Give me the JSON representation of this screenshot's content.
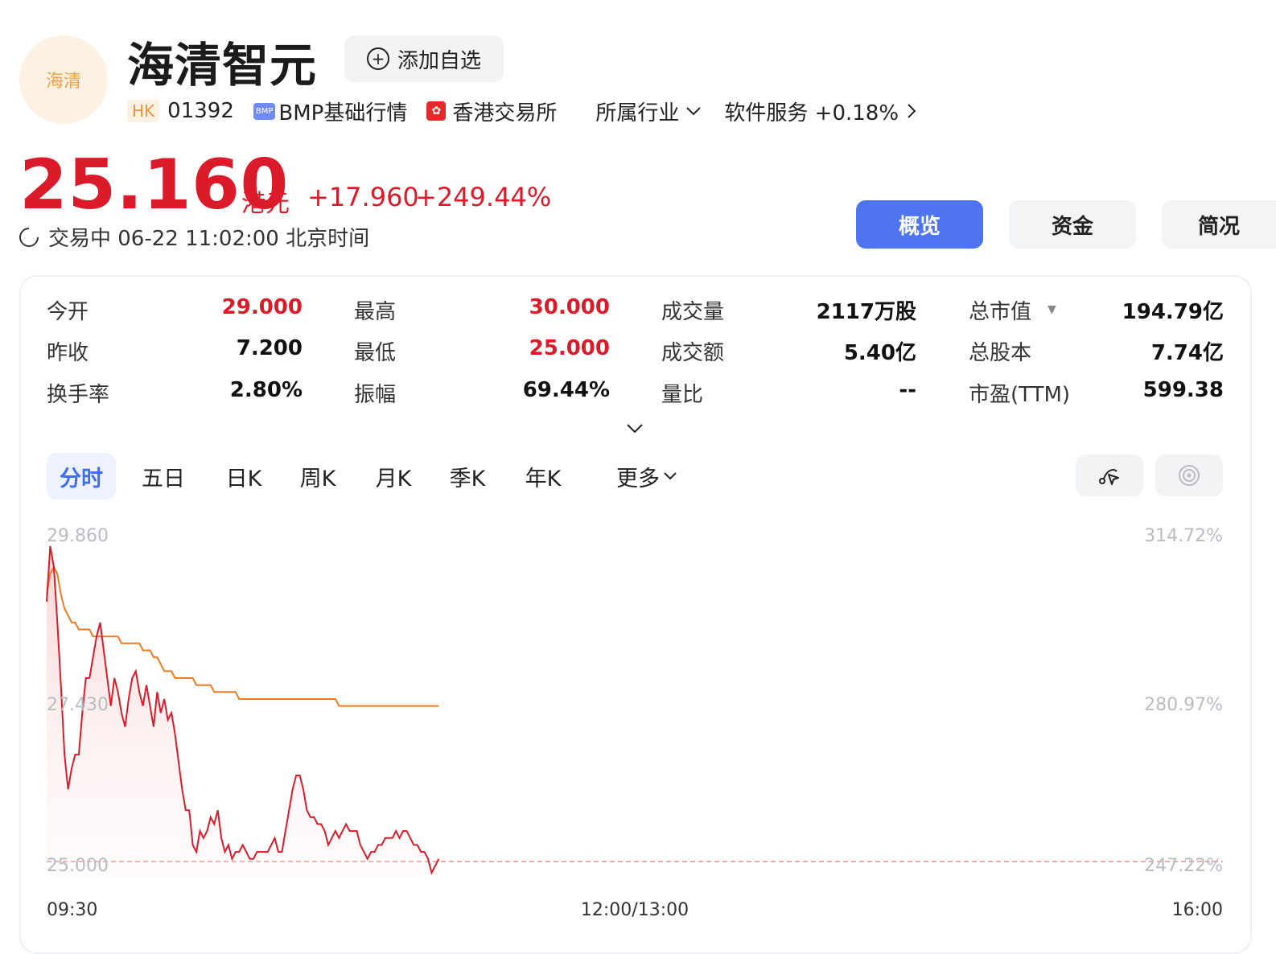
{
  "header": {
    "logo_text": "海清",
    "stock_name": "海清智元",
    "watch_button": "添加自选",
    "market_badge": "HK",
    "code": "01392",
    "bmp_badge": "BMP",
    "bmp_label": "BMP基础行情",
    "exchange": "香港交易所",
    "industry_label": "所属行业",
    "sector": "软件服务 +0.18%"
  },
  "quote": {
    "price": "25.160",
    "currency": "港元",
    "change": "+17.960",
    "change_pct": "+249.44%",
    "status": "交易中 06-22 11:02:00 北京时间"
  },
  "tabs": [
    "概览",
    "资金",
    "简况"
  ],
  "stats": [
    [
      {
        "label": "今开",
        "value": "29.000"
      },
      {
        "label": "最高",
        "value": "30.000"
      },
      {
        "label": "成交量",
        "value": "2117万股"
      },
      {
        "label": "总市值",
        "value": "194.79亿"
      }
    ],
    [
      {
        "label": "昨收",
        "value": "7.200"
      },
      {
        "label": "最低",
        "value": "25.000"
      },
      {
        "label": "成交额",
        "value": "5.40亿"
      },
      {
        "label": "总股本",
        "value": "7.74亿"
      }
    ],
    [
      {
        "label": "换手率",
        "value": "2.80%"
      },
      {
        "label": "振幅",
        "value": "69.44%"
      },
      {
        "label": "量比",
        "value": "--"
      },
      {
        "label": "市盈(TTM)",
        "value": "599.38"
      }
    ]
  ],
  "periods": [
    "分时",
    "五日",
    "日K",
    "周K",
    "月K",
    "季K",
    "年K",
    "更多"
  ],
  "colors": {
    "up": "#dc1b2a",
    "avg": "#f07a22",
    "accent": "#4f74ef"
  },
  "chart_data": {
    "type": "line",
    "y_left_labels": [
      "29.860",
      "27.430",
      "25.000"
    ],
    "y_right_labels": [
      "314.72%",
      "280.97%",
      "247.22%"
    ],
    "x_labels": [
      "09:30",
      "12:00/13:00",
      "16:00"
    ],
    "ylim": [
      25.0,
      29.86
    ],
    "reference_line": 25.16,
    "series": [
      {
        "key": "price",
        "values": [
          28.9,
          29.7,
          29.4,
          28.6,
          27.7,
          26.7,
          26.2,
          26.5,
          26.7,
          26.7,
          27.3,
          27.8,
          27.8,
          28.1,
          28.4,
          28.6,
          28.2,
          27.8,
          27.4,
          27.8,
          27.6,
          27.3,
          27.1,
          27.5,
          27.8,
          27.9,
          27.6,
          27.4,
          27.7,
          27.4,
          27.1,
          27.6,
          27.3,
          27.5,
          27.2,
          27.3,
          27.0,
          26.6,
          26.2,
          25.9,
          25.9,
          25.4,
          25.3,
          25.6,
          25.5,
          25.6,
          25.8,
          25.7,
          25.9,
          25.5,
          25.3,
          25.4,
          25.2,
          25.3,
          25.3,
          25.4,
          25.3,
          25.2,
          25.2,
          25.3,
          25.3,
          25.3,
          25.3,
          25.4,
          25.5,
          25.3,
          25.3,
          25.6,
          25.9,
          26.2,
          26.4,
          26.4,
          26.2,
          25.9,
          25.8,
          25.8,
          25.7,
          25.7,
          25.6,
          25.4,
          25.5,
          25.6,
          25.5,
          25.6,
          25.7,
          25.6,
          25.6,
          25.6,
          25.4,
          25.3,
          25.2,
          25.3,
          25.3,
          25.4,
          25.4,
          25.5,
          25.5,
          25.5,
          25.6,
          25.5,
          25.6,
          25.6,
          25.5,
          25.4,
          25.4,
          25.3,
          25.3,
          25.2,
          25.0,
          25.1,
          25.2
        ]
      },
      {
        "key": "average",
        "values": [
          29.0,
          29.3,
          29.4,
          29.3,
          29.0,
          28.8,
          28.7,
          28.6,
          28.6,
          28.5,
          28.5,
          28.5,
          28.5,
          28.4,
          28.4,
          28.4,
          28.4,
          28.4,
          28.4,
          28.4,
          28.4,
          28.3,
          28.3,
          28.3,
          28.3,
          28.3,
          28.3,
          28.2,
          28.2,
          28.2,
          28.1,
          28.1,
          28.0,
          27.9,
          27.9,
          27.9,
          27.8,
          27.8,
          27.8,
          27.8,
          27.8,
          27.8,
          27.7,
          27.7,
          27.7,
          27.7,
          27.7,
          27.6,
          27.6,
          27.6,
          27.6,
          27.6,
          27.6,
          27.6,
          27.5,
          27.5,
          27.5,
          27.5,
          27.5,
          27.5,
          27.5,
          27.5,
          27.5,
          27.5,
          27.5,
          27.5,
          27.5,
          27.5,
          27.5,
          27.5,
          27.5,
          27.5,
          27.5,
          27.5,
          27.5,
          27.5,
          27.5,
          27.5,
          27.5,
          27.5,
          27.5,
          27.5,
          27.4,
          27.4,
          27.4,
          27.4,
          27.4,
          27.4,
          27.4,
          27.4,
          27.4,
          27.4,
          27.4,
          27.4,
          27.4,
          27.4,
          27.4,
          27.4,
          27.4,
          27.4,
          27.4,
          27.4,
          27.4,
          27.4,
          27.4,
          27.4,
          27.4,
          27.4,
          27.4,
          27.4,
          27.4
        ]
      }
    ]
  }
}
